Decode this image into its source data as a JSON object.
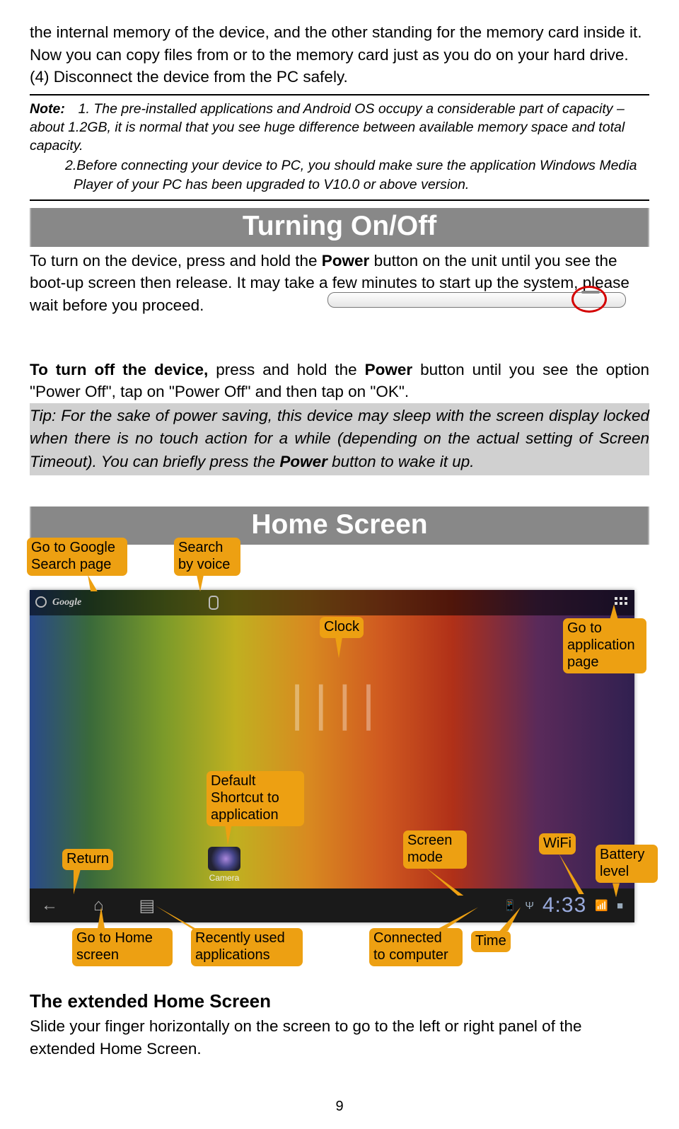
{
  "para1_a": "the internal memory of the device, and the other standing for the memory card inside it. Now you can copy files from or to the memory card just as you do on your hard drive.",
  "para1_b": "(4) Disconnect the device from the PC safely.",
  "note_label": "Note:",
  "note_1": "1. The pre-installed applications and Android OS occupy a considerable part of capacity – about 1.2GB, it is normal that you see huge difference between available memory space and total capacity.",
  "note_2": "2.Before connecting your device to PC, you should make sure the application Windows Media Player of your PC has been upgraded to V10.0 or above version.",
  "section1_title": "Turning On/Off",
  "turnon_a": "To turn on the device, press and hold the ",
  "turnon_b": "Power",
  "turnon_c": " button on the unit until you see the boot-up screen then release. It may take a few minutes to start up the system, please wait before you proceed.",
  "turnoff_a": "To turn off the device,",
  "turnoff_b": " press and hold the ",
  "turnoff_c": "Power",
  "turnoff_d": " button until you see the option \"Power Off\", tap on \"Power Off\" and then tap on \"OK\".",
  "tip_a": "Tip: For the sake of power saving, this device may sleep with the screen display locked when there is no touch action for a while (depending on the actual setting of Screen Timeout). You can briefly press the ",
  "tip_b": "Power",
  "tip_c": " button to wake it up.",
  "section2_title": "Home Screen",
  "callouts": {
    "google_search": "Go to Google\nSearch page",
    "search_voice": "Search\nby voice",
    "clock": "Clock",
    "app_page": "Go to\napplication\npage",
    "default_shortcut": "Default\nShortcut   to\napplication",
    "return": "Return",
    "home_screen": "Go to Home\nscreen",
    "recent": "Recently used\napplications",
    "screen_mode": "Screen\nmode",
    "connected": "Connected\nto computer",
    "wifi": "WiFi",
    "time": "Time",
    "battery": "Battery\nlevel"
  },
  "hs": {
    "google": "Google",
    "camera": "Camera",
    "time": "4:33",
    "clock_digits": "| |  | |"
  },
  "ext_heading": "The extended Home Screen",
  "ext_body": "Slide your finger horizontally on the screen to go to the left or right panel of the extended Home Screen.",
  "page_num": "9"
}
